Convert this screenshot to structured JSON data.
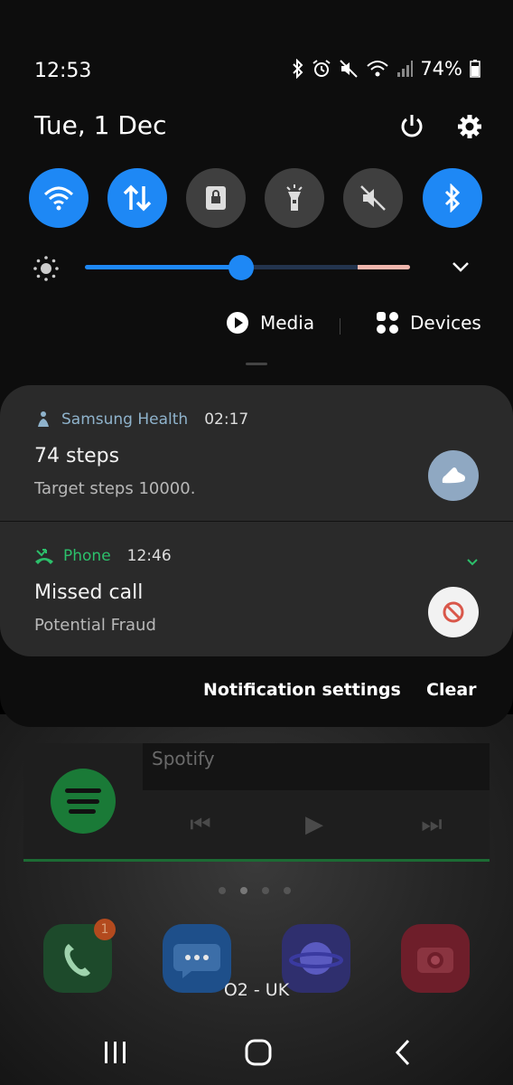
{
  "status_bar": {
    "time": "12:53",
    "battery": "74%"
  },
  "header": {
    "date": "Tue, 1 Dec"
  },
  "quick_settings": [
    {
      "name": "wifi",
      "state": "on"
    },
    {
      "name": "mobile-data",
      "state": "on"
    },
    {
      "name": "screen-lock",
      "state": "off"
    },
    {
      "name": "flashlight",
      "state": "off"
    },
    {
      "name": "mute",
      "state": "off"
    },
    {
      "name": "bluetooth",
      "state": "on"
    }
  ],
  "brightness": {
    "level": 0.48
  },
  "media_row": {
    "media_label": "Media",
    "devices_label": "Devices"
  },
  "notifications": [
    {
      "app": "Samsung Health",
      "time": "02:17",
      "title": "74 steps",
      "body": "Target steps 10000.",
      "app_color": "#8fb3cc"
    },
    {
      "app": "Phone",
      "time": "12:46",
      "title": "Missed call",
      "body": "Potential Fraud",
      "app_color": "#2cc06b"
    }
  ],
  "panel_actions": {
    "settings_label": "Notification settings",
    "clear_label": "Clear"
  },
  "home": {
    "spotify_label": "Spotify",
    "phone_badge": "1",
    "carrier": "O2 - UK"
  },
  "colors": {
    "accent": "#1e88f5",
    "panel": "#0d0d0d",
    "card": "#2a2a2a"
  }
}
